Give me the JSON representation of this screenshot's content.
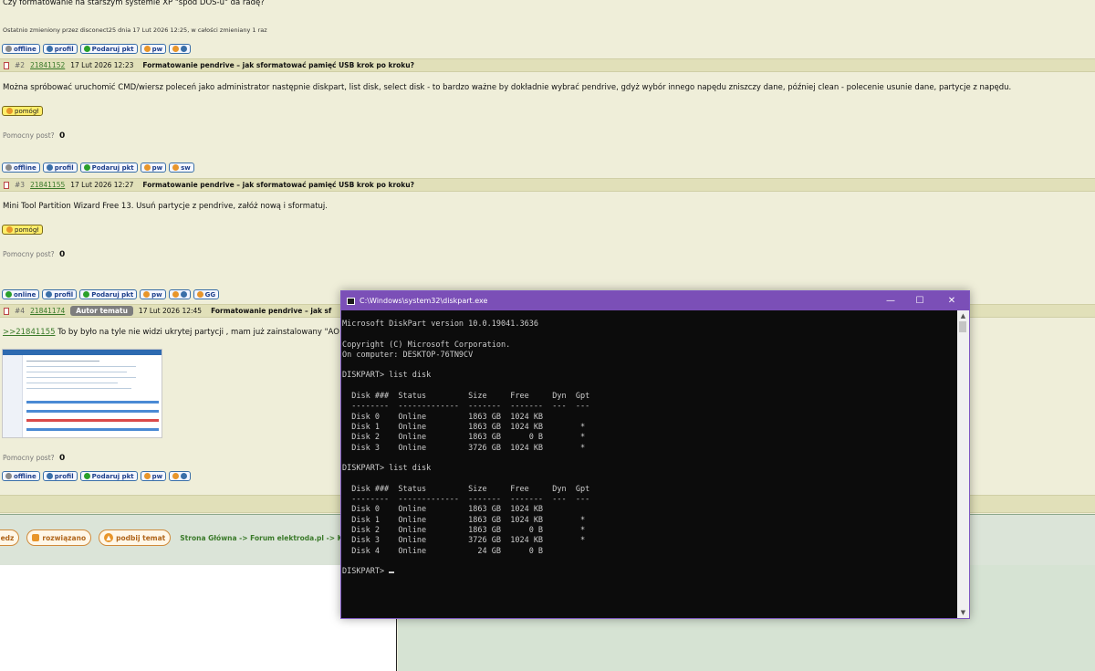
{
  "post1": {
    "question": "Czy formatowanie na starszym systemie XP \"spod DOS-u\" da radę?",
    "edited": "Ostatnio zmieniony przez disconect25 dnia 17 Lut 2026 12:25, w całości zmieniany 1 raz"
  },
  "buttons": {
    "offline": "offline",
    "online": "online",
    "profil": "profil",
    "podaruj": "Podaruj pkt",
    "pw": "pw",
    "sw": "sw",
    "gg": "GG",
    "pomogl": "pomógł"
  },
  "post2": {
    "num": "#2",
    "id": "21841152",
    "date": "17 Lut 2026 12:23",
    "title": "Formatowanie pendrive – jak sformatować pamięć USB krok po kroku?",
    "body": "Można spróbować uruchomić CMD/wiersz poleceń jako administrator następnie diskpart, list disk, select disk - to bardzo ważne by dokładnie wybrać pendrive, gdyż wybór innego napędu zniszczy dane, później clean - polecenie usunie dane, partycje z napędu.",
    "helpful_label": "Pomocny post?",
    "helpful_count": "0"
  },
  "post3": {
    "num": "#3",
    "id": "21841155",
    "date": "17 Lut 2026 12:27",
    "title": "Formatowanie pendrive – jak sformatować pamięć USB krok po kroku?",
    "body": "Mini Tool Partition Wizard Free 13. Usuń partycje z pendrive, załóż nową i sformatuj.",
    "helpful_label": "Pomocny post?",
    "helpful_count": "0"
  },
  "post4": {
    "num": "#4",
    "id": "21841174",
    "badge": "Autor tematu",
    "date": "17 Lut 2026 12:45",
    "title": "Formatowanie pendrive – jak sf",
    "quote_ref": ">>21841155",
    "body": "To by było na tyle nie widzi ukrytej partycji , mam już zainstalowany \"AO",
    "helpful_label": "Pomocny post?",
    "helpful_count": "0"
  },
  "bottom": {
    "btn_odpowiedz": "iedz",
    "btn_rozwiazano": "rozwiązano",
    "btn_podbij": "podbij temat",
    "breadcrumb": "Strona Główna -> Forum elektroda.pl -> Komp"
  },
  "diskpart": {
    "title": "C:\\Windows\\system32\\diskpart.exe",
    "output": "Microsoft DiskPart version 10.0.19041.3636\n\nCopyright (C) Microsoft Corporation.\nOn computer: DESKTOP-76TN9CV\n\nDISKPART> list disk\n\n  Disk ###  Status         Size     Free     Dyn  Gpt\n  --------  -------------  -------  -------  ---  ---\n  Disk 0    Online         1863 GB  1024 KB\n  Disk 1    Online         1863 GB  1024 KB        *\n  Disk 2    Online         1863 GB      0 B        *\n  Disk 3    Online         3726 GB  1024 KB        *\n\nDISKPART> list disk\n\n  Disk ###  Status         Size     Free     Dyn  Gpt\n  --------  -------------  -------  -------  ---  ---\n  Disk 0    Online         1863 GB  1024 KB\n  Disk 1    Online         1863 GB  1024 KB        *\n  Disk 2    Online         1863 GB      0 B        *\n  Disk 3    Online         3726 GB  1024 KB        *\n  Disk 4    Online           24 GB      0 B\n\n",
    "prompt": "DISKPART> ",
    "minimize": "—",
    "maximize": "☐",
    "close": "✕"
  }
}
